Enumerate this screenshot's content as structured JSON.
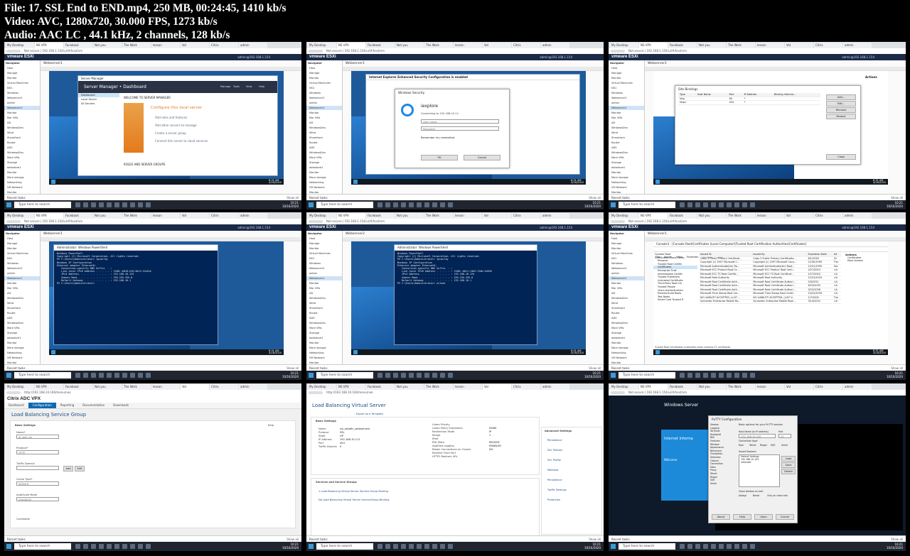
{
  "header": {
    "line1": "File: 17. SSL End to END.mp4, 250 MB, 00:24:45, 1410 kb/s",
    "line2": "Video: AVC, 1280x720, 30.000 FPS, 1273 kb/s",
    "line3": "Audio: AAC LC , 44.1 kHz, 2 channels, 128 kb/s"
  },
  "common": {
    "esxi_logo": "vmware ESXi",
    "user": "admin@192.168.1.154",
    "url_esxi": "Not secure | 192.168.1.154/ui/#/host/vm",
    "url_citrix": "http://192.168.10.160/menu/neo",
    "search_placeholder": "Type here to search",
    "recent_tasks": "Recent tasks",
    "recent_right": "Show all",
    "clock_time": "10:21",
    "clock_date": "10/16/2020",
    "vm_clock_time": "8:31 AM",
    "vm_clock_date": "4/16/2020",
    "tabs": [
      "My Desktop",
      "NS VPX",
      "Facebook",
      "Not you",
      "The Work",
      "lesson",
      "Vol",
      "Citrix",
      "admin"
    ],
    "nav": [
      "Navigator",
      "Host",
      "Manage",
      "Monitor",
      "Virtual Machines",
      "NS1",
      "Windows",
      "Webserver2",
      "admin",
      "Webserver1",
      "Monitor",
      "Mor VMs",
      "AD",
      "WindowsDns",
      "Wind",
      "Sharefront",
      "Router",
      "ADS",
      "WindowsDns",
      "More VMs",
      "Storage",
      "datastore1",
      "Monitor",
      "More storage",
      "Networking",
      "VM Network",
      "Monitor",
      "wsetwork"
    ]
  },
  "thumbs": [
    {
      "id": "t1",
      "content_title": "Webserver1",
      "window_title": "Server Manager",
      "sm_title": "Server Manager • Dashboard",
      "sm_side": [
        "Dashboard",
        "Local Server",
        "All Servers"
      ],
      "sm_welcome": "WELCOME TO SERVER MANAGER",
      "sm_configure": "Configure this local server",
      "sm_links": [
        "Add roles and features",
        "Add other servers to manage",
        "Create a server group",
        "Connect this server to cloud services"
      ],
      "sm_roles": "ROLES AND SERVER GROUPS",
      "sm_menu": [
        "Manage",
        "Tools",
        "View",
        "Help"
      ]
    },
    {
      "id": "t2",
      "content_title": "Webserver1",
      "ie_title": "Internet Explorer Enhanced Security Configuration is enabled",
      "sec_title": "Windows Security",
      "sec_app": "iexplore",
      "sec_connect": "Connecting to 192.168.10.11.",
      "sec_user": "User name",
      "sec_pass": "Password",
      "sec_remember": "Remember my credentials",
      "ok": "OK",
      "cancel": "Cancel"
    },
    {
      "id": "t3",
      "content_title": "Webserver1",
      "dialog_title": "Site Bindings",
      "cols": [
        "Type",
        "Host Name",
        "Port",
        "IP Address",
        "Binding Informa..."
      ],
      "rows": [
        [
          "http",
          "",
          "80",
          "*",
          ""
        ],
        [
          "https",
          "",
          "443",
          "*",
          ""
        ]
      ],
      "buttons": [
        "Add...",
        "Edit...",
        "Remove",
        "Browse"
      ],
      "close": "Close",
      "actions": "Actions"
    },
    {
      "id": "t4",
      "content_title": "Webserver1",
      "ps_title": "Administrator: Windows PowerShell",
      "ps_lines": [
        "Windows PowerShell",
        "Copyright (C) Microsoft Corporation. All rights reserved.",
        "",
        "PS C:\\Users\\Administrator> ipconfig",
        "",
        "Windows IP Configuration",
        "",
        "",
        "Ethernet adapter Ethernet0:",
        "",
        "   Connection-specific DNS Suffix  . :",
        "   Link-local IPv6 Address . . . . . : fe80::b816:ef0:4b21:12a4%4",
        "   IPv4 Address. . . . . . . . . . . : 192.168.10.123",
        "   Subnet Mask . . . . . . . . . . . : 255.255.255.0",
        "   Default Gateway . . . . . . . . . : 192.168.10.1",
        "PS C:\\Users\\Administrator>"
      ]
    },
    {
      "id": "t5",
      "content_title": "Webserver2",
      "ps_title": "Administrator: Windows PowerShell",
      "ps_lines": [
        "Windows PowerShell",
        "Copyright (C) Microsoft Corporation. All rights reserved.",
        "",
        "PS C:\\Users\\Administrator> ipconfig",
        "",
        "Windows IP Configuration",
        "",
        "",
        "Ethernet adapter Ethernet0:",
        "",
        "   Connection-specific DNS Suffix  . :",
        "   Link-local IPv6 Address . . . . . : fe80::b0c1:14b5:f2db:1d6%8",
        "   IPv4 Address. . . . . . . . . . . : 192.168.10.124",
        "   Subnet Mask . . . . . . . . . . . : 255.255.255.0",
        "   Default Gateway . . . . . . . . . : 192.168.10.1",
        "PS C:\\Users\\Administrator> nslook"
      ]
    },
    {
      "id": "t6",
      "content_title": "Webserver1",
      "mmc_title": "Console1 - [Console Root\\Certificates (Local Computer)\\Trusted Root Certification Authorities\\Certificates]",
      "mmc_menu": [
        "File",
        "Action",
        "View",
        "Favorites",
        "Window",
        "Help"
      ],
      "tree": [
        "Console Root",
        "Certificates (Local Comp",
        "Personal",
        "Trusted Root Certific",
        "Certificates",
        "Enterprise Trust",
        "Intermediate Certific",
        "Trusted Publishers",
        "Untrusted Certificate",
        "Third-Party Root Cer",
        "Trusted People",
        "Client Authentication",
        "Preview Build Roots",
        "Test Roots",
        "Smart Card Trusted R"
      ],
      "cols": [
        "Issued To",
        "Issued By",
        "Expiration Date",
        "Int"
      ],
      "rows": [
        [
          "Class 3 Public Primary Certificati...",
          "Class 3 Public Primary Certificatio...",
          "8/1/2028",
          "Cli"
        ],
        [
          "Copyright (c) 1997 Microsoft C...",
          "Copyright (c) 1997 Microsoft Corp...",
          "12/30/1999",
          "Tim"
        ],
        [
          "Microsoft Authenticode(tm) Ro...",
          "Microsoft Authenticode(tm) Root...",
          "12/31/1999",
          "Sec"
        ],
        [
          "Microsoft ECC Product Root Ce...",
          "Microsoft ECC Product Root Certi...",
          "2/27/2043",
          "<A"
        ],
        [
          "Microsoft ECC TS Root Certific...",
          "Microsoft ECC TS Root Certificat...",
          "2/27/2043",
          "<A"
        ],
        [
          "Microsoft Root Authority",
          "Microsoft Root Authority",
          "12/31/2020",
          "<A"
        ],
        [
          "Microsoft Root Certificate Auth...",
          "Microsoft Root Certificate Authori...",
          "5/9/2021",
          "<A"
        ],
        [
          "Microsoft Root Certificate Auth...",
          "Microsoft Root Certificate Authori...",
          "6/23/2035",
          "<A"
        ],
        [
          "Microsoft Root Certificate Auth...",
          "Microsoft Root Certificate Authori...",
          "3/22/2036",
          "<A"
        ],
        [
          "Microsoft Time Stamp Root Cer...",
          "Microsoft Time Stamp Root Certif...",
          "10/22/2039",
          "<A"
        ],
        [
          "NO LIABILITY ACCEPTED, (c)97 ...",
          "NO LIABILITY ACCEPTED, (c)97 V...",
          "1/7/2004",
          "Tim"
        ],
        [
          "Symantec Enterprise Mobile Ro...",
          "Symantec Enterprise Mobile Root...",
          "3/14/2032",
          "<A"
        ]
      ],
      "actions_title": "Actions",
      "actions": [
        "Certificates",
        "More Actions"
      ],
      "status": "Trusted Root Certification Authorities store contains 27 certificates."
    },
    {
      "id": "t7",
      "brand": "Citrix ADC VPX",
      "nav": [
        "Dashboard",
        "Configuration",
        "Reporting",
        "Documentation",
        "Downloads"
      ],
      "page_title": "Load Balancing Service Group",
      "section": "Basic Settings",
      "fields": [
        {
          "label": "Name*",
          "value": "lb_web_ssl"
        },
        {
          "label": "Protocol*",
          "value": "HTTP"
        },
        {
          "label": "Traffic Domain",
          "value": ""
        },
        {
          "label": "Cache Type*",
          "value": "SERVER"
        },
        {
          "label": "AutoScale Mode",
          "value": "DISABLED"
        }
      ],
      "buttons": [
        "Add",
        "Edit"
      ],
      "checkbox": "Cacheable",
      "help": "Help"
    },
    {
      "id": "t8",
      "page_title": "Load Balancing Virtual Server",
      "export": "Export as a Template",
      "section": "Basic Settings",
      "left_labels": [
        "Name",
        "Protocol",
        "State",
        "IP Address",
        "Port",
        "Traffic Domain"
      ],
      "left_values": [
        "vsl_ssltofin_webservers",
        "SSL",
        "UP",
        "192.168.10.111",
        "443",
        "0"
      ],
      "right_labels": [
        "Listen Priority",
        "Listen Policy Expression",
        "Redirection Mode",
        "Range",
        "IPset",
        "RHI State",
        "AppFlow Logging",
        "Retain Connections on Cluster",
        "Redirect From Port",
        "HTTPS Redirect URL"
      ],
      "right_values": [
        "",
        "NONE",
        "IP",
        "1",
        "",
        "PASSIVE",
        "ENABLED",
        "NO",
        "",
        ""
      ],
      "services_title": "Services and Service Groups",
      "services": [
        "1 Load Balancing Virtual Server Service Group Binding",
        "No Load Balancing Virtual Server ServiceGroup Binding"
      ],
      "advanced": "Advanced Settings",
      "adv_items": [
        "Persistence",
        "SSL Policies",
        "SSL Profile",
        "Methods",
        "Persistence",
        "Traffic Settings",
        "Protection"
      ]
    },
    {
      "id": "t9",
      "putty_title": "PuTTY Configuration",
      "putty_header": "Basic options for your PuTTY session",
      "putty_host_label": "Host Name (or IP address)",
      "putty_host": "192.168.10.105",
      "putty_port_label": "Port",
      "putty_port": "22",
      "putty_conn": "Connection type:",
      "putty_types": [
        "Raw",
        "Telnet",
        "Rlogin",
        "SSH",
        "Serial"
      ],
      "putty_sessions": "Saved Sessions",
      "putty_list": [
        "Default Settings",
        "192.168.10.105",
        "netscaler"
      ],
      "putty_buttons": [
        "Load",
        "Save",
        "Delete"
      ],
      "putty_close": "Close window on exit:",
      "putty_close_opts": [
        "Always",
        "Never",
        "Only on clean exit"
      ],
      "putty_bottom": [
        "About",
        "Help",
        "Open",
        "Cancel"
      ],
      "tree": [
        "Session",
        "Logging",
        "Terminal",
        "Keyboard",
        "Bell",
        "Features",
        "Window",
        "Appearance",
        "Behaviour",
        "Translation",
        "Selection",
        "Colours",
        "Connection",
        "Data",
        "Proxy",
        "Telnet",
        "Rlogin",
        "SSH",
        "Serial"
      ],
      "ws_title": "Windows Server",
      "ie_text": "Internet Informa",
      "welcome": "Welcome"
    }
  ]
}
